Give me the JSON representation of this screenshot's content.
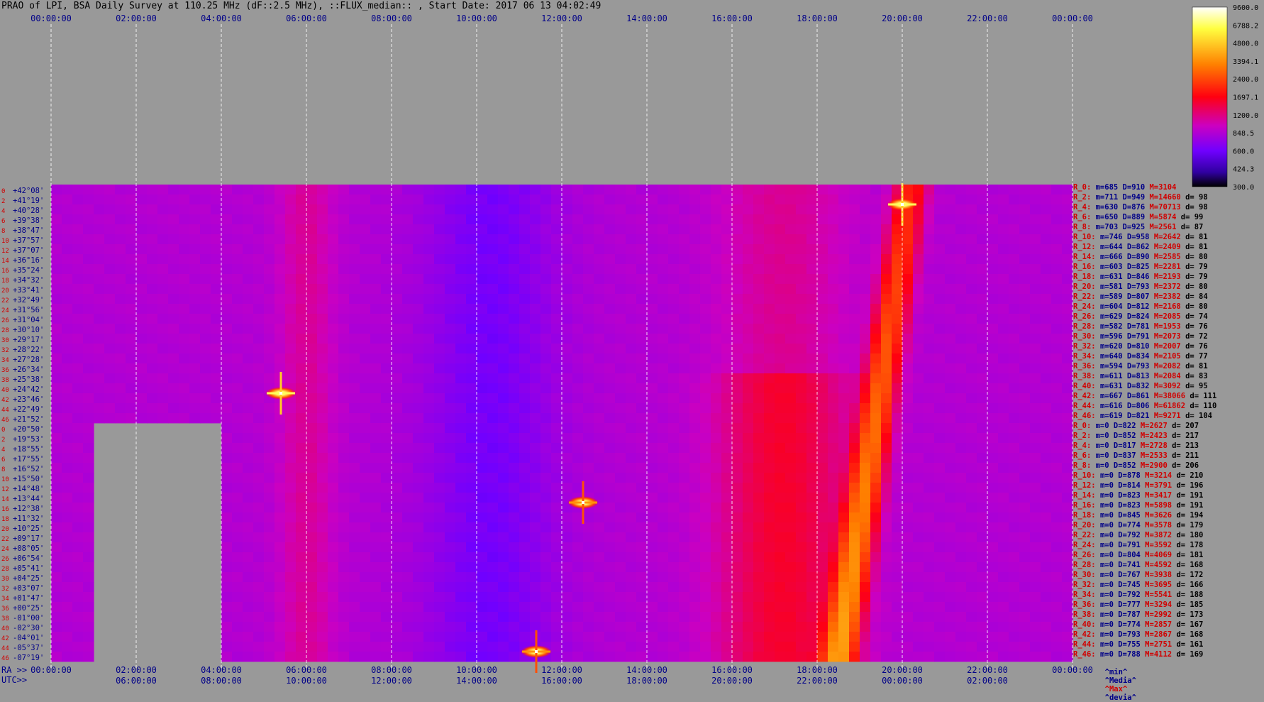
{
  "title": "PRAO of LPI, BSA Daily Survey at 110.25 MHz (dF::2.5 MHz), ::FLUX_median:: , Start Date: 2017 06 13 04:02:49",
  "chart_data": {
    "type": "heatmap",
    "title": "PRAO of LPI, BSA Daily Survey at 110.25 MHz (dF::2.5 MHz), ::FLUX_median:: , Start Date: 2017 06 13 04:02:49",
    "x_range_hours": [
      0,
      24
    ],
    "grid": "vertical dashed every 2 hours",
    "top_x_ticks": [
      "00:00:00",
      "02:00:00",
      "04:00:00",
      "06:00:00",
      "08:00:00",
      "10:00:00",
      "12:00:00",
      "14:00:00",
      "16:00:00",
      "18:00:00",
      "20:00:00",
      "22:00:00",
      "00:00:00"
    ],
    "bottom_ra_ticks": [
      "00:00:00",
      "02:00:00",
      "04:00:00",
      "06:00:00",
      "08:00:00",
      "10:00:00",
      "12:00:00",
      "14:00:00",
      "16:00:00",
      "18:00:00",
      "20:00:00",
      "22:00:00",
      "00:00:00"
    ],
    "bottom_utc_ticks": [
      "06:00:00",
      "08:00:00",
      "10:00:00",
      "12:00:00",
      "14:00:00",
      "16:00:00",
      "18:00:00",
      "20:00:00",
      "22:00:00",
      "00:00:00",
      "02:00:00"
    ],
    "bottom_ra_label": "RA >>",
    "bottom_utc_label": "UTC>>",
    "beam_numbers": [
      "0",
      "2",
      "4",
      "6",
      "8",
      "10",
      "12",
      "14",
      "16",
      "18",
      "20",
      "22",
      "24",
      "26",
      "28",
      "30",
      "32",
      "34",
      "36",
      "38",
      "40",
      "42",
      "44",
      "46",
      "0",
      "2",
      "4",
      "6",
      "8",
      "10",
      "12",
      "14",
      "16",
      "18",
      "20",
      "22",
      "24",
      "26",
      "28",
      "30",
      "32",
      "34",
      "36",
      "38",
      "40",
      "42",
      "44",
      "46"
    ],
    "declinations": [
      "+42°08'",
      "+41°19'",
      "+40°28'",
      "+39°38'",
      "+38°47'",
      "+37°57'",
      "+37°07'",
      "+36°16'",
      "+35°24'",
      "+34°32'",
      "+33°41'",
      "+32°49'",
      "+31°56'",
      "+31°04'",
      "+30°10'",
      "+29°17'",
      "+28°22'",
      "+27°28'",
      "+26°34'",
      "+25°38'",
      "+24°42'",
      "+23°46'",
      "+22°49'",
      "+21°52'",
      "+20°50'",
      "+19°53'",
      "+18°55'",
      "+17°55'",
      "+16°52'",
      "+15°50'",
      "+14°48'",
      "+13°44'",
      "+12°38'",
      "+11°32'",
      "+10°25'",
      "+09°17'",
      "+08°05'",
      "+06°54'",
      "+05°41'",
      "+04°25'",
      "+03°07'",
      "+01°47'",
      "+00°25'",
      "-01°00'",
      "-02°30'",
      "-04°01'",
      "-05°37'",
      "-07°19'"
    ],
    "colorbar": {
      "ticks": [
        "9600.0",
        "6788.2",
        "4800.0",
        "3394.1",
        "2400.0",
        "1697.1",
        "1200.0",
        "848.5",
        "600.0",
        "424.3",
        "300.0"
      ],
      "range": [
        300,
        9600
      ],
      "scale": "log"
    },
    "stats": [
      {
        "label": "R_0:",
        "min": "685",
        "med": "910",
        "max": "3104",
        "dev": ""
      },
      {
        "label": "R_2:",
        "min": "711",
        "med": "949",
        "max": "14660",
        "dev": "98"
      },
      {
        "label": "R_4:",
        "min": "630",
        "med": "876",
        "max": "70713",
        "dev": "98"
      },
      {
        "label": "R_6:",
        "min": "650",
        "med": "889",
        "max": "5874",
        "dev": "99"
      },
      {
        "label": "R_8:",
        "min": "703",
        "med": "925",
        "max": "2561",
        "dev": "87"
      },
      {
        "label": "R_10:",
        "min": "746",
        "med": "958",
        "max": "2642",
        "dev": "81"
      },
      {
        "label": "R_12:",
        "min": "644",
        "med": "862",
        "max": "2409",
        "dev": "81"
      },
      {
        "label": "R_14:",
        "min": "666",
        "med": "890",
        "max": "2585",
        "dev": "80"
      },
      {
        "label": "R_16:",
        "min": "603",
        "med": "825",
        "max": "2281",
        "dev": "79"
      },
      {
        "label": "R_18:",
        "min": "631",
        "med": "846",
        "max": "2193",
        "dev": "79"
      },
      {
        "label": "R_20:",
        "min": "581",
        "med": "793",
        "max": "2372",
        "dev": "80"
      },
      {
        "label": "R_22:",
        "min": "589",
        "med": "807",
        "max": "2382",
        "dev": "84"
      },
      {
        "label": "R_24:",
        "min": "604",
        "med": "812",
        "max": "2168",
        "dev": "80"
      },
      {
        "label": "R_26:",
        "min": "629",
        "med": "824",
        "max": "2085",
        "dev": "74"
      },
      {
        "label": "R_28:",
        "min": "582",
        "med": "781",
        "max": "1953",
        "dev": "76"
      },
      {
        "label": "R_30:",
        "min": "596",
        "med": "791",
        "max": "2073",
        "dev": "72"
      },
      {
        "label": "R_32:",
        "min": "620",
        "med": "810",
        "max": "2007",
        "dev": "76"
      },
      {
        "label": "R_34:",
        "min": "640",
        "med": "834",
        "max": "2105",
        "dev": "77"
      },
      {
        "label": "R_36:",
        "min": "594",
        "med": "793",
        "max": "2082",
        "dev": "81"
      },
      {
        "label": "R_38:",
        "min": "611",
        "med": "813",
        "max": "2084",
        "dev": "83"
      },
      {
        "label": "R_40:",
        "min": "631",
        "med": "832",
        "max": "3092",
        "dev": "95"
      },
      {
        "label": "R_42:",
        "min": "667",
        "med": "861",
        "max": "38066",
        "dev": "111"
      },
      {
        "label": "R_44:",
        "min": "616",
        "med": "806",
        "max": "61862",
        "dev": "110"
      },
      {
        "label": "R_46:",
        "min": "619",
        "med": "821",
        "max": "9271",
        "dev": "104"
      },
      {
        "label": "R_0:",
        "min": "0",
        "med": "822",
        "max": "2627",
        "dev": "207"
      },
      {
        "label": "R_2:",
        "min": "0",
        "med": "852",
        "max": "2423",
        "dev": "217"
      },
      {
        "label": "R_4:",
        "min": "0",
        "med": "817",
        "max": "2728",
        "dev": "213"
      },
      {
        "label": "R_6:",
        "min": "0",
        "med": "837",
        "max": "2533",
        "dev": "211"
      },
      {
        "label": "R_8:",
        "min": "0",
        "med": "852",
        "max": "2900",
        "dev": "206"
      },
      {
        "label": "R_10:",
        "min": "0",
        "med": "878",
        "max": "3214",
        "dev": "210"
      },
      {
        "label": "R_12:",
        "min": "0",
        "med": "814",
        "max": "3791",
        "dev": "196"
      },
      {
        "label": "R_14:",
        "min": "0",
        "med": "823",
        "max": "3417",
        "dev": "191"
      },
      {
        "label": "R_16:",
        "min": "0",
        "med": "823",
        "max": "5898",
        "dev": "191"
      },
      {
        "label": "R_18:",
        "min": "0",
        "med": "845",
        "max": "3626",
        "dev": "194"
      },
      {
        "label": "R_20:",
        "min": "0",
        "med": "774",
        "max": "3578",
        "dev": "179"
      },
      {
        "label": "R_22:",
        "min": "0",
        "med": "792",
        "max": "3872",
        "dev": "180"
      },
      {
        "label": "R_24:",
        "min": "0",
        "med": "791",
        "max": "3592",
        "dev": "178"
      },
      {
        "label": "R_26:",
        "min": "0",
        "med": "804",
        "max": "4069",
        "dev": "181"
      },
      {
        "label": "R_28:",
        "min": "0",
        "med": "741",
        "max": "4592",
        "dev": "168"
      },
      {
        "label": "R_30:",
        "min": "0",
        "med": "767",
        "max": "3938",
        "dev": "172"
      },
      {
        "label": "R_32:",
        "min": "0",
        "med": "745",
        "max": "3695",
        "dev": "166"
      },
      {
        "label": "R_34:",
        "min": "0",
        "med": "792",
        "max": "5541",
        "dev": "188"
      },
      {
        "label": "R_36:",
        "min": "0",
        "med": "777",
        "max": "3294",
        "dev": "185"
      },
      {
        "label": "R_38:",
        "min": "0",
        "med": "787",
        "max": "2992",
        "dev": "173"
      },
      {
        "label": "R_40:",
        "min": "0",
        "med": "774",
        "max": "2857",
        "dev": "167"
      },
      {
        "label": "R_42:",
        "min": "0",
        "med": "793",
        "max": "2867",
        "dev": "168"
      },
      {
        "label": "R_44:",
        "min": "0",
        "med": "755",
        "max": "2751",
        "dev": "161"
      },
      {
        "label": "R_46:",
        "min": "0",
        "med": "788",
        "max": "4112",
        "dev": "169"
      }
    ],
    "stats_footer": {
      "min": "^min^",
      "median": "^Media^",
      "max": "^Max^",
      "dev": "^devia^"
    },
    "sources": [
      {
        "name": "",
        "ra_h": 5.4,
        "dec_row": 21,
        "intensity": 9600
      },
      {
        "name": "",
        "ra_h": 20.0,
        "dec_row": 2,
        "intensity": 9600
      },
      {
        "name": "",
        "ra_h": 12.5,
        "dec_row": 32,
        "intensity": 5000
      },
      {
        "name": "",
        "ra_h": 11.4,
        "dec_row": 47,
        "intensity": 5000
      }
    ],
    "sun_track": {
      "ra_h_top": 20.2,
      "ra_h_bottom": 18.5
    },
    "masked_region": {
      "ra_h_start": 1.0,
      "ra_h_end": 4.0,
      "row_start": 24,
      "row_end": 48
    }
  }
}
